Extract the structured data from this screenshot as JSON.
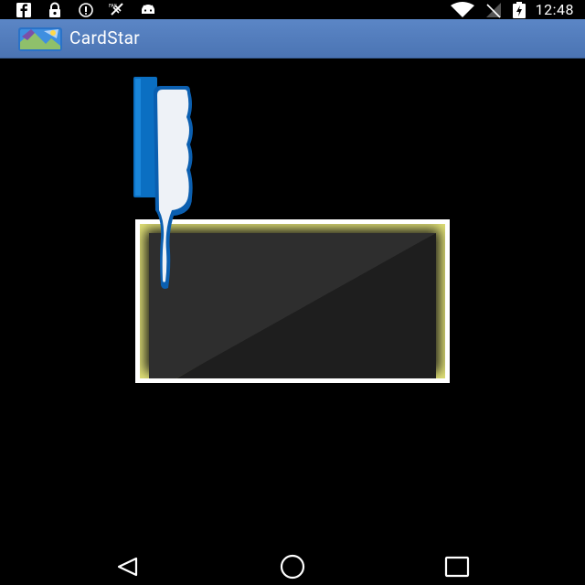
{
  "status_bar": {
    "left_icons": [
      "facebook-icon",
      "lock-icon",
      "sync-icon",
      "no-gps-icon",
      "android-icon"
    ],
    "right_icons": [
      "wifi-icon",
      "no-signal-icon",
      "battery-charging-icon"
    ],
    "time": "12:48"
  },
  "app_bar": {
    "title": "CardStar",
    "icon": "cardstar-app-icon",
    "color": "#5b86c6"
  },
  "scan_area": {
    "frame_color": "#ffffff",
    "glow_color": "#e8e87a",
    "illustration": "phone-scanning-card"
  },
  "nav_bar": {
    "buttons": [
      "back-icon",
      "home-icon",
      "recents-icon"
    ]
  }
}
